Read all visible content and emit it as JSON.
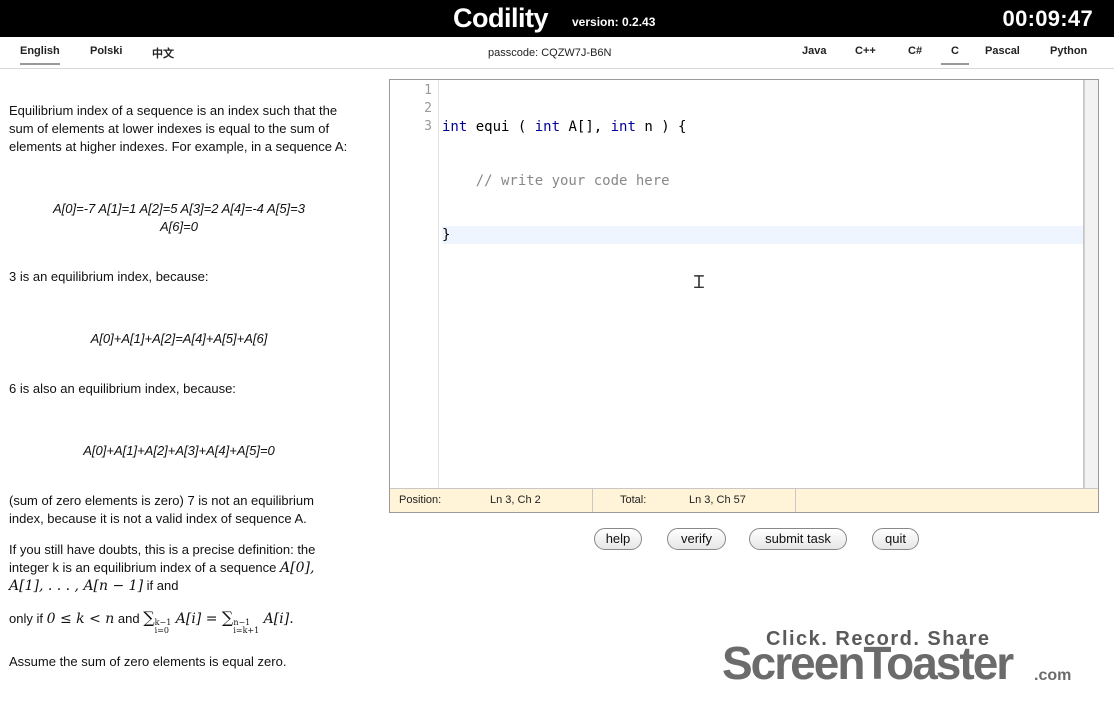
{
  "header": {
    "brand": "Codility",
    "version": "version: 0.2.43",
    "timer": "00:09:47"
  },
  "languages_ui": [
    {
      "label": "English",
      "active": true
    },
    {
      "label": "Polski",
      "active": false
    },
    {
      "label": "中文",
      "active": false
    }
  ],
  "passcode": "passcode: CQZW7J-B6N",
  "languages_code": [
    {
      "label": "Java",
      "active": false
    },
    {
      "label": "C++",
      "active": false
    },
    {
      "label": "C#",
      "active": false
    },
    {
      "label": "C",
      "active": true
    },
    {
      "label": "Pascal",
      "active": false
    },
    {
      "label": "Python",
      "active": false
    }
  ],
  "description": {
    "p1": "Equilibrium index of a sequence is an index such that the sum of elements at lower indexes is equal to the sum of elements at higher indexes. For example, in a sequence A:",
    "seq_line1": "A[0]=-7 A[1]=1 A[2]=5 A[3]=2 A[4]=-4 A[5]=3",
    "seq_line2": "A[6]=0",
    "p2": "3 is an equilibrium index, because:",
    "f1": "A[0]+A[1]+A[2]=A[4]+A[5]+A[6]",
    "p3": "6 is also an equilibrium index, because:",
    "f2": "A[0]+A[1]+A[2]+A[3]+A[4]+A[5]=0",
    "p4": "(sum of zero elements is zero) 7 is not an equilibrium index, because it is not a valid index of sequence A.",
    "p5a": "If you still have doubts, this is a precise definition: the integer k is an equilibrium index of a sequence",
    "p5_math1": "A[0], A[1], . . . , A[n − 1]",
    "p5b": "if and",
    "p5c": "only if",
    "p5_math2": "0 ≤ k < n",
    "p5d": "and",
    "p6": "Assume the sum of zero elements is equal zero."
  },
  "editor": {
    "line_numbers": [
      "1",
      "2",
      "3"
    ],
    "code_line1": {
      "kw1": "int",
      "rest1": " equi ( ",
      "kw2": "int",
      "rest2": " A[], ",
      "kw3": "int",
      "rest3": " n ) {"
    },
    "code_line2": "    // write your code here",
    "code_line3": "}",
    "status": {
      "position_label": "Position:",
      "position_value": "Ln 3, Ch 2",
      "total_label": "Total:",
      "total_value": "Ln 3, Ch 57"
    }
  },
  "buttons": {
    "help": "help",
    "verify": "verify",
    "submit": "submit task",
    "quit": "quit"
  },
  "watermark": {
    "tagline": "Click. Record. Share",
    "brand": "ScreenToaster",
    "tld": ".com"
  },
  "colors": {
    "header_bg": "#000000",
    "status_bg": "#fff3d8",
    "keyword": "#000099",
    "comment": "#888888"
  }
}
